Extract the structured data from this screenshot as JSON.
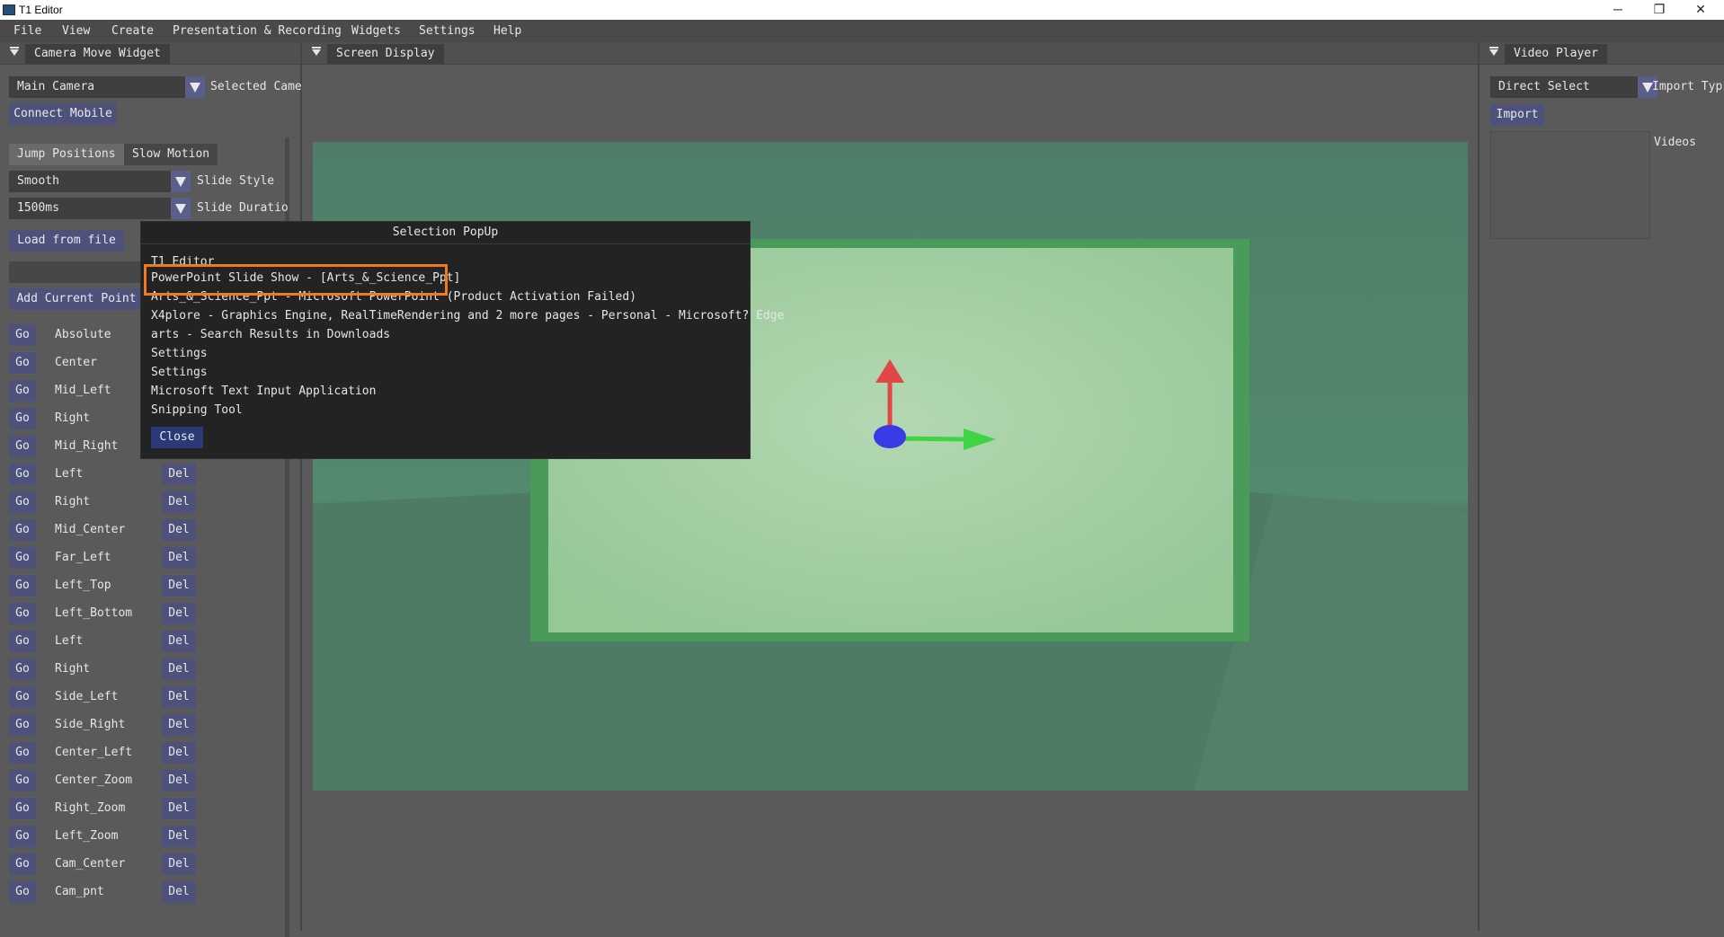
{
  "window": {
    "title": "T1 Editor",
    "minimize": "─",
    "maximize": "❐",
    "close": "✕"
  },
  "menu": [
    "File",
    "View",
    "Create",
    "Presentation & Recording",
    "Widgets",
    "Settings",
    "Help"
  ],
  "left_panel": {
    "tab": "Camera Move Widget",
    "camera_select": "Main Camera",
    "camera_label": "Selected Came",
    "connect_mobile": "Connect Mobile",
    "tabs": [
      "Jump Positions",
      "Slow Motion"
    ],
    "slide_style": {
      "value": "Smooth",
      "label": "Slide Style"
    },
    "slide_duration": {
      "value": "1500ms",
      "label": "Slide Duratio"
    },
    "load_from_file": "Load from file",
    "add_current_point": "Add Current Point",
    "go_label": "Go",
    "del_label": "Del",
    "positions": [
      "Absolute",
      "Center",
      "Mid_Left",
      "Right",
      "Mid_Right",
      "Left",
      "Right",
      "Mid_Center",
      "Far_Left",
      "Left_Top",
      "Left_Bottom",
      "Left",
      "Right",
      "Side_Left",
      "Side_Right",
      "Center_Left",
      "Center_Zoom",
      "Right_Zoom",
      "Left_Zoom",
      "Cam_Center",
      "Cam_pnt"
    ]
  },
  "center_panel": {
    "tab": "Screen Display"
  },
  "right_panel": {
    "tab": "Video Player",
    "select": "Direct Select",
    "select_label": "Import Typ",
    "import": "Import",
    "videos_label": "Videos"
  },
  "popup": {
    "title": "Selection PopUp",
    "items": [
      "T1 Editor",
      "PowerPoint Slide Show - [Arts_&_Science_Ppt]",
      "Arts_&_Science_Ppt - Microsoft PowerPoint (Product Activation Failed)",
      "X4plore - Graphics Engine, RealTimeRendering and 2 more pages - Personal - Microsoft? Edge",
      "arts - Search Results in Downloads",
      "Settings",
      "Settings",
      "Microsoft Text Input Application",
      "Snipping Tool"
    ],
    "close": "Close"
  },
  "colors": {
    "accent_button": "#4e527a",
    "highlight": "#f07a1d",
    "popup_bg": "#232323"
  }
}
